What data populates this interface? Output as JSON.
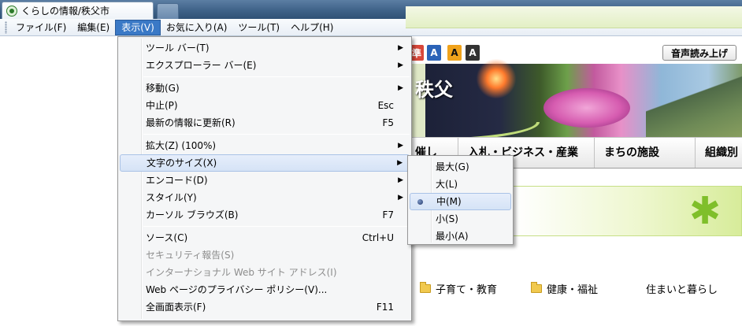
{
  "tab": {
    "title": "くらしの情報/秩父市"
  },
  "menubar": [
    {
      "label": "ファイル(F)"
    },
    {
      "label": "編集(E)"
    },
    {
      "label": "表示(V)"
    },
    {
      "label": "お気に入り(A)"
    },
    {
      "label": "ツール(T)"
    },
    {
      "label": "ヘルプ(H)"
    }
  ],
  "view_menu": {
    "items": [
      {
        "label": "ツール バー(T)",
        "shortcut": "",
        "submenu": true
      },
      {
        "label": "エクスプローラー バー(E)",
        "shortcut": "",
        "submenu": true
      },
      {
        "label": "移動(G)",
        "shortcut": "",
        "submenu": true
      },
      {
        "label": "中止(P)",
        "shortcut": "Esc",
        "submenu": false
      },
      {
        "label": "最新の情報に更新(R)",
        "shortcut": "F5",
        "submenu": false
      },
      {
        "label": "拡大(Z) (100%)",
        "shortcut": "",
        "submenu": true
      },
      {
        "label": "文字のサイズ(X)",
        "shortcut": "",
        "submenu": true
      },
      {
        "label": "エンコード(D)",
        "shortcut": "",
        "submenu": true
      },
      {
        "label": "スタイル(Y)",
        "shortcut": "",
        "submenu": true
      },
      {
        "label": "カーソル ブラウズ(B)",
        "shortcut": "F7",
        "submenu": false
      },
      {
        "label": "ソース(C)",
        "shortcut": "Ctrl+U",
        "submenu": false
      },
      {
        "label": "セキュリティ報告(S)",
        "shortcut": "",
        "submenu": false,
        "disabled": true
      },
      {
        "label": "インターナショナル Web サイト アドレス(I)",
        "shortcut": "",
        "submenu": false,
        "disabled": true
      },
      {
        "label": "Web ページのプライバシー ポリシー(V)...",
        "shortcut": "",
        "submenu": false
      },
      {
        "label": "全画面表示(F)",
        "shortcut": "F11",
        "submenu": false
      }
    ]
  },
  "text_size_menu": {
    "items": [
      {
        "label": "最大(G)"
      },
      {
        "label": "大(L)"
      },
      {
        "label": "中(M)",
        "selected": true
      },
      {
        "label": "小(S)"
      },
      {
        "label": "最小(A)"
      }
    ]
  },
  "page": {
    "font_size_buttons": [
      "準",
      "A",
      "A",
      "A"
    ],
    "voice_button": "音声読み上げ",
    "banner_logo": "秩父",
    "nav": [
      "催し",
      "入札・ビジネス・産業",
      "まちの施設",
      "組織別"
    ],
    "categories": [
      "子育て・教育",
      "健康・福祉",
      "住まいと暮らし"
    ]
  },
  "colors": {
    "menu_active": "#3a79c6",
    "menu_highlight": "#d5e3f6",
    "font_btn_standard": "#d8473a",
    "font_btn_small": "#2b63b8",
    "font_btn_medium": "#f0a31c",
    "font_btn_large": "#333333"
  },
  "icons": {
    "tab": "globe-favicon-icon",
    "submenu": "chevron-right-icon",
    "radio": "radio-dot-icon",
    "folder": "folder-icon"
  }
}
